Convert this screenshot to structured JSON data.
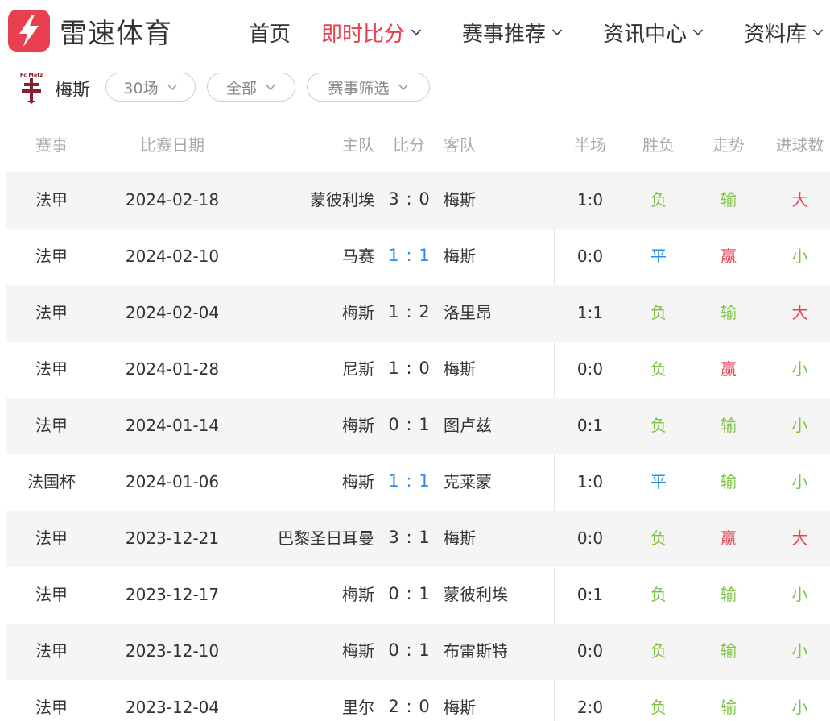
{
  "brand": {
    "name": "雷速体育",
    "logo_color": "#e8404f"
  },
  "nav": [
    {
      "label": "首页",
      "active": false,
      "has_dropdown": false
    },
    {
      "label": "即时比分",
      "active": true,
      "has_dropdown": true
    },
    {
      "label": "赛事推荐",
      "active": false,
      "has_dropdown": true
    },
    {
      "label": "资讯中心",
      "active": false,
      "has_dropdown": true
    },
    {
      "label": "资料库",
      "active": false,
      "has_dropdown": true
    }
  ],
  "team": {
    "crest_text": "Fc Metz",
    "name": "梅斯"
  },
  "filters": [
    {
      "label": "30场"
    },
    {
      "label": "全部"
    },
    {
      "label": "赛事筛选"
    }
  ],
  "table": {
    "headers": {
      "league": "赛事",
      "date": "比赛日期",
      "home": "主队",
      "score": "比分",
      "away": "客队",
      "half": "半场",
      "result": "胜负",
      "trend": "走势",
      "goals": "进球数"
    },
    "rows": [
      {
        "league": "法甲",
        "date": "2024-02-18",
        "home": "蒙彼利埃",
        "home_score": "3",
        "sep": ":",
        "away_score": "0",
        "away": "梅斯",
        "half": "1:0",
        "result": "负",
        "trend": "输",
        "goals": "大"
      },
      {
        "league": "法甲",
        "date": "2024-02-10",
        "home": "马赛",
        "home_score": "1",
        "sep": ":",
        "away_score": "1",
        "away": "梅斯",
        "half": "0:0",
        "result": "平",
        "trend": "赢",
        "goals": "小"
      },
      {
        "league": "法甲",
        "date": "2024-02-04",
        "home": "梅斯",
        "home_score": "1",
        "sep": ":",
        "away_score": "2",
        "away": "洛里昂",
        "half": "1:1",
        "result": "负",
        "trend": "输",
        "goals": "大"
      },
      {
        "league": "法甲",
        "date": "2024-01-28",
        "home": "尼斯",
        "home_score": "1",
        "sep": ":",
        "away_score": "0",
        "away": "梅斯",
        "half": "0:0",
        "result": "负",
        "trend": "赢",
        "goals": "小"
      },
      {
        "league": "法甲",
        "date": "2024-01-14",
        "home": "梅斯",
        "home_score": "0",
        "sep": ":",
        "away_score": "1",
        "away": "图卢兹",
        "half": "0:1",
        "result": "负",
        "trend": "输",
        "goals": "小"
      },
      {
        "league": "法国杯",
        "date": "2024-01-06",
        "home": "梅斯",
        "home_score": "1",
        "sep": ":",
        "away_score": "1",
        "away": "克莱蒙",
        "half": "1:0",
        "result": "平",
        "trend": "输",
        "goals": "小"
      },
      {
        "league": "法甲",
        "date": "2023-12-21",
        "home": "巴黎圣日耳曼",
        "home_score": "3",
        "sep": ":",
        "away_score": "1",
        "away": "梅斯",
        "half": "0:0",
        "result": "负",
        "trend": "赢",
        "goals": "大"
      },
      {
        "league": "法甲",
        "date": "2023-12-17",
        "home": "梅斯",
        "home_score": "0",
        "sep": ":",
        "away_score": "1",
        "away": "蒙彼利埃",
        "half": "0:1",
        "result": "负",
        "trend": "输",
        "goals": "小"
      },
      {
        "league": "法甲",
        "date": "2023-12-10",
        "home": "梅斯",
        "home_score": "0",
        "sep": ":",
        "away_score": "1",
        "away": "布雷斯特",
        "half": "0:0",
        "result": "负",
        "trend": "输",
        "goals": "小"
      },
      {
        "league": "法甲",
        "date": "2023-12-04",
        "home": "里尔",
        "home_score": "2",
        "sep": ":",
        "away_score": "0",
        "away": "梅斯",
        "half": "2:0",
        "result": "负",
        "trend": "输",
        "goals": "小"
      }
    ]
  },
  "colors": {
    "accent": "#e8404f",
    "loss": "#7cc242",
    "draw": "#2b8ef0",
    "win": "#e8404f",
    "over": "#e8404f",
    "under": "#7cc242",
    "header_text": "#aaaaaa"
  }
}
